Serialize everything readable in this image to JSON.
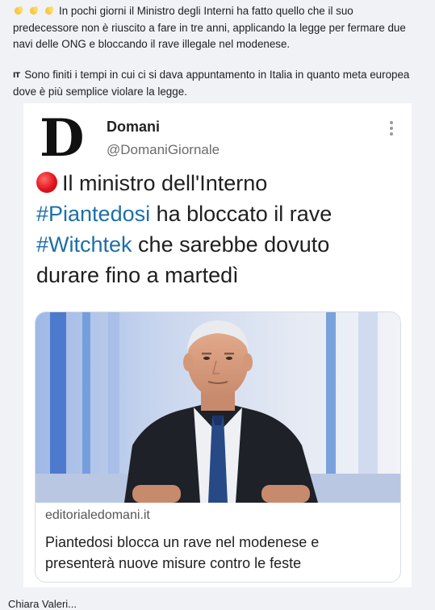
{
  "post": {
    "line1": "In pochi giorni il Ministro degli Interni ha fatto quello che il suo",
    "line2": "predecessore non è riuscito a fare in tre anni, applicando la legge per fermare due",
    "line3": "navi delle ONG e bloccando il rave illegale nel modenese.",
    "flag_label": "IT",
    "line4": "Sono finiti i tempi in cui ci si dava appuntamento in Italia in quanto meta europea",
    "line5": "dove è più semplice violare la legge."
  },
  "tweet": {
    "avatar_letter": "D",
    "account_name": "Domani",
    "handle": "@DomaniGiornale",
    "text_part1": "Il ministro dell'Interno",
    "hashtag1": "#Piantedosi",
    "text_part2": " ha bloccato il rave",
    "hashtag2": "#Witchtek",
    "text_part3": " che sarebbe dovuto",
    "text_part4": "durare fino a martedì",
    "link_domain": "editorialedomani.it",
    "link_title_line1": "Piantedosi blocca un rave nel modenese e",
    "link_title_line2": "presenterà nuove misure contro le feste"
  },
  "comment": {
    "author": "Chiara Valeri..."
  },
  "colors": {
    "background": "#f0f2f5",
    "hashtag": "#1d6fa8",
    "red_circle": "#e0151c",
    "studio_blue": "#5d8fd6"
  },
  "icons": [
    "clapping-hands-icon",
    "italy-flag-icon",
    "red-circle-icon",
    "more-options-icon"
  ]
}
